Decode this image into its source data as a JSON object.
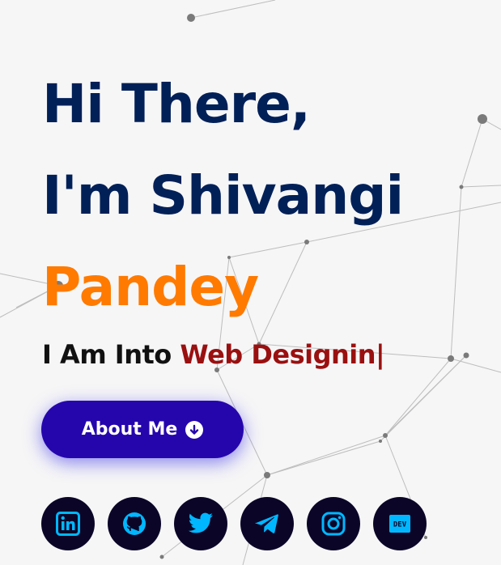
{
  "hero": {
    "line1": "Hi There,",
    "line2": "I'm Shivangi",
    "line3": "Pandey",
    "typing_prefix": "I Am Into ",
    "typing_text": "Web Designin",
    "cursor": "|"
  },
  "about_button": {
    "label": "About Me",
    "icon": "arrow-down-circle-icon"
  },
  "socials": [
    {
      "name": "linkedin",
      "icon": "linkedin-icon"
    },
    {
      "name": "github",
      "icon": "github-icon"
    },
    {
      "name": "twitter",
      "icon": "twitter-icon"
    },
    {
      "name": "telegram",
      "icon": "telegram-icon"
    },
    {
      "name": "instagram",
      "icon": "instagram-icon"
    },
    {
      "name": "dev",
      "icon": "dev-icon",
      "text": "DEV"
    }
  ],
  "colors": {
    "background": "#f6f6f7",
    "headline": "#022058",
    "accent": "#ff7a00",
    "typed": "#9a1010",
    "button": "#2506ad",
    "social_bg": "#0b0628",
    "social_icon": "#00b7ff"
  }
}
